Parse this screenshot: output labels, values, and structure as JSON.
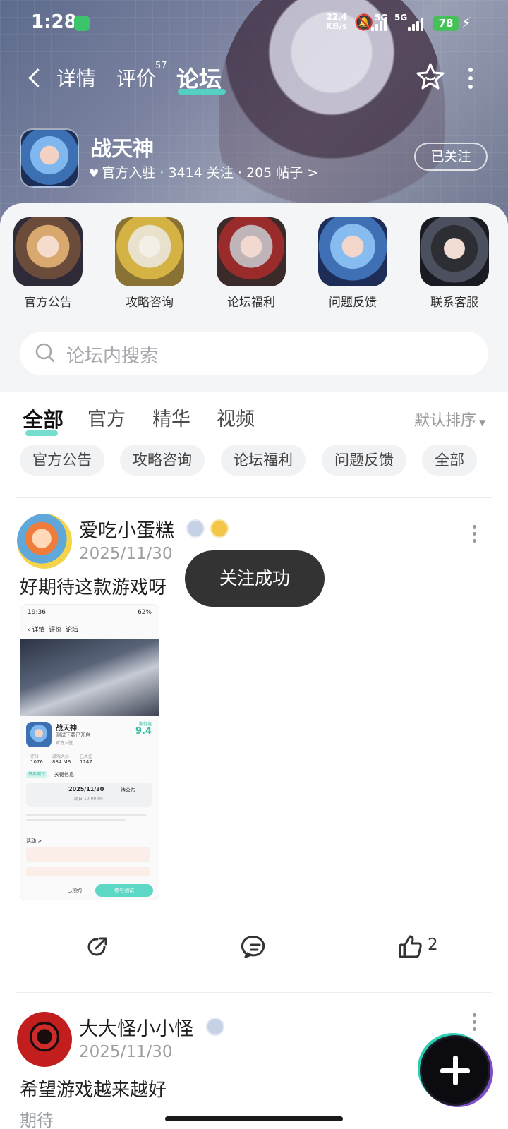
{
  "status_bar": {
    "time": "1:28",
    "net_speed_value": "22.4",
    "net_speed_unit": "KB/s",
    "signal1": "5G",
    "signal2": "5G",
    "battery": "78"
  },
  "nav": {
    "tabs": [
      {
        "label": "详情"
      },
      {
        "label": "评价",
        "badge": "57"
      },
      {
        "label": "论坛"
      }
    ],
    "active_tab": "论坛"
  },
  "game": {
    "name": "战天神",
    "meta": "官方入驻 · 3414 关注 · 205 帖子 >",
    "follow_label": "已关注"
  },
  "shortcuts": [
    {
      "label": "官方公告"
    },
    {
      "label": "攻略咨询"
    },
    {
      "label": "论坛福利"
    },
    {
      "label": "问题反馈"
    },
    {
      "label": "联系客服"
    }
  ],
  "search": {
    "placeholder": "论坛内搜索"
  },
  "filter_tabs": [
    {
      "label": "全部"
    },
    {
      "label": "官方"
    },
    {
      "label": "精华"
    },
    {
      "label": "视频"
    }
  ],
  "sort_label": "默认排序",
  "chips": [
    {
      "label": "官方公告"
    },
    {
      "label": "攻略咨询"
    },
    {
      "label": "论坛福利"
    },
    {
      "label": "问题反馈"
    },
    {
      "label": "全部"
    }
  ],
  "posts": [
    {
      "username": "爱吃小蛋糕",
      "date": "2025/11/30",
      "text": "好期待这款游戏呀",
      "like_count": "2",
      "screenshot": {
        "time": "19:36",
        "battery": "62%",
        "tabs": [
          "详情",
          "评价",
          "论坛"
        ],
        "game_name": "战天神",
        "subtitle": "测试下载已开启",
        "official": "官方入驻",
        "score_label": "期待值",
        "score": "9.4",
        "stats": [
          {
            "label": "评分",
            "value": "1076"
          },
          {
            "label": "游戏大小",
            "value": "884 MB"
          },
          {
            "label": "已关注",
            "value": "1147"
          }
        ],
        "test_tag": "开启测试",
        "test_label": "关键信息",
        "date": "2025/11/30",
        "date_sub": "周日 10:00:00",
        "pending": "待公布",
        "activity": "活动 >",
        "join_button": "参与测试",
        "booked_button": "已预约"
      }
    },
    {
      "username": "大大怪小小怪",
      "date": "2025/11/30",
      "text": "希望游戏越来越好",
      "tag": "期待"
    }
  ],
  "toast": "关注成功",
  "colors": {
    "accent": "#4fd8c4",
    "toast_bg": "#333333",
    "chip_bg": "#f1f2f4"
  }
}
